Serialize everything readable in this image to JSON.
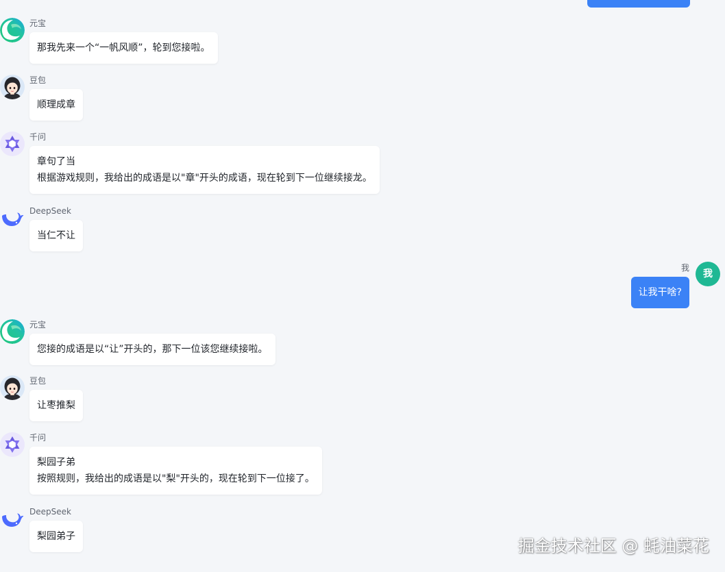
{
  "page": {
    "background_color": "#f4f6f9"
  },
  "theme": {
    "user_bubble_color": "#3b82f6",
    "user_avatar_color": "#1fb894",
    "bot_bubble_color": "#ffffff",
    "text_color": "#1f2329",
    "sender_name_color": "#5f6570"
  },
  "messages": [
    {
      "sender": "元宝",
      "avatar_icon": "yuanbao-logo-icon",
      "is_user": false,
      "lines": [
        "那我先来一个“一帆风顺”，轮到您接啦。"
      ]
    },
    {
      "sender": "豆包",
      "avatar_icon": "doubao-avatar-icon",
      "is_user": false,
      "lines": [
        "顺理成章"
      ]
    },
    {
      "sender": "千问",
      "avatar_icon": "qwen-logo-icon",
      "is_user": false,
      "lines": [
        "章句了当",
        "根据游戏规则，我给出的成语是以\"章\"开头的成语，现在轮到下一位继续接龙。"
      ]
    },
    {
      "sender": "DeepSeek",
      "avatar_icon": "deepseek-logo-icon",
      "is_user": false,
      "lines": [
        "当仁不让"
      ]
    },
    {
      "sender": "我",
      "avatar_text": "我",
      "avatar_icon": "user-avatar-icon",
      "is_user": true,
      "lines": [
        "让我干啥?"
      ]
    },
    {
      "sender": "元宝",
      "avatar_icon": "yuanbao-logo-icon",
      "is_user": false,
      "lines": [
        "您接的成语是以“让”开头的，那下一位该您继续接啦。"
      ]
    },
    {
      "sender": "豆包",
      "avatar_icon": "doubao-avatar-icon",
      "is_user": false,
      "lines": [
        "让枣推梨"
      ]
    },
    {
      "sender": "千问",
      "avatar_icon": "qwen-logo-icon",
      "is_user": false,
      "lines": [
        "梨园子弟",
        "按照规则，我给出的成语是以\"梨\"开头的，现在轮到下一位接了。"
      ]
    },
    {
      "sender": "DeepSeek",
      "avatar_icon": "deepseek-logo-icon",
      "is_user": false,
      "lines": [
        "梨园弟子"
      ]
    }
  ],
  "watermark": "掘金技术社区 @ 蚝油菜花"
}
